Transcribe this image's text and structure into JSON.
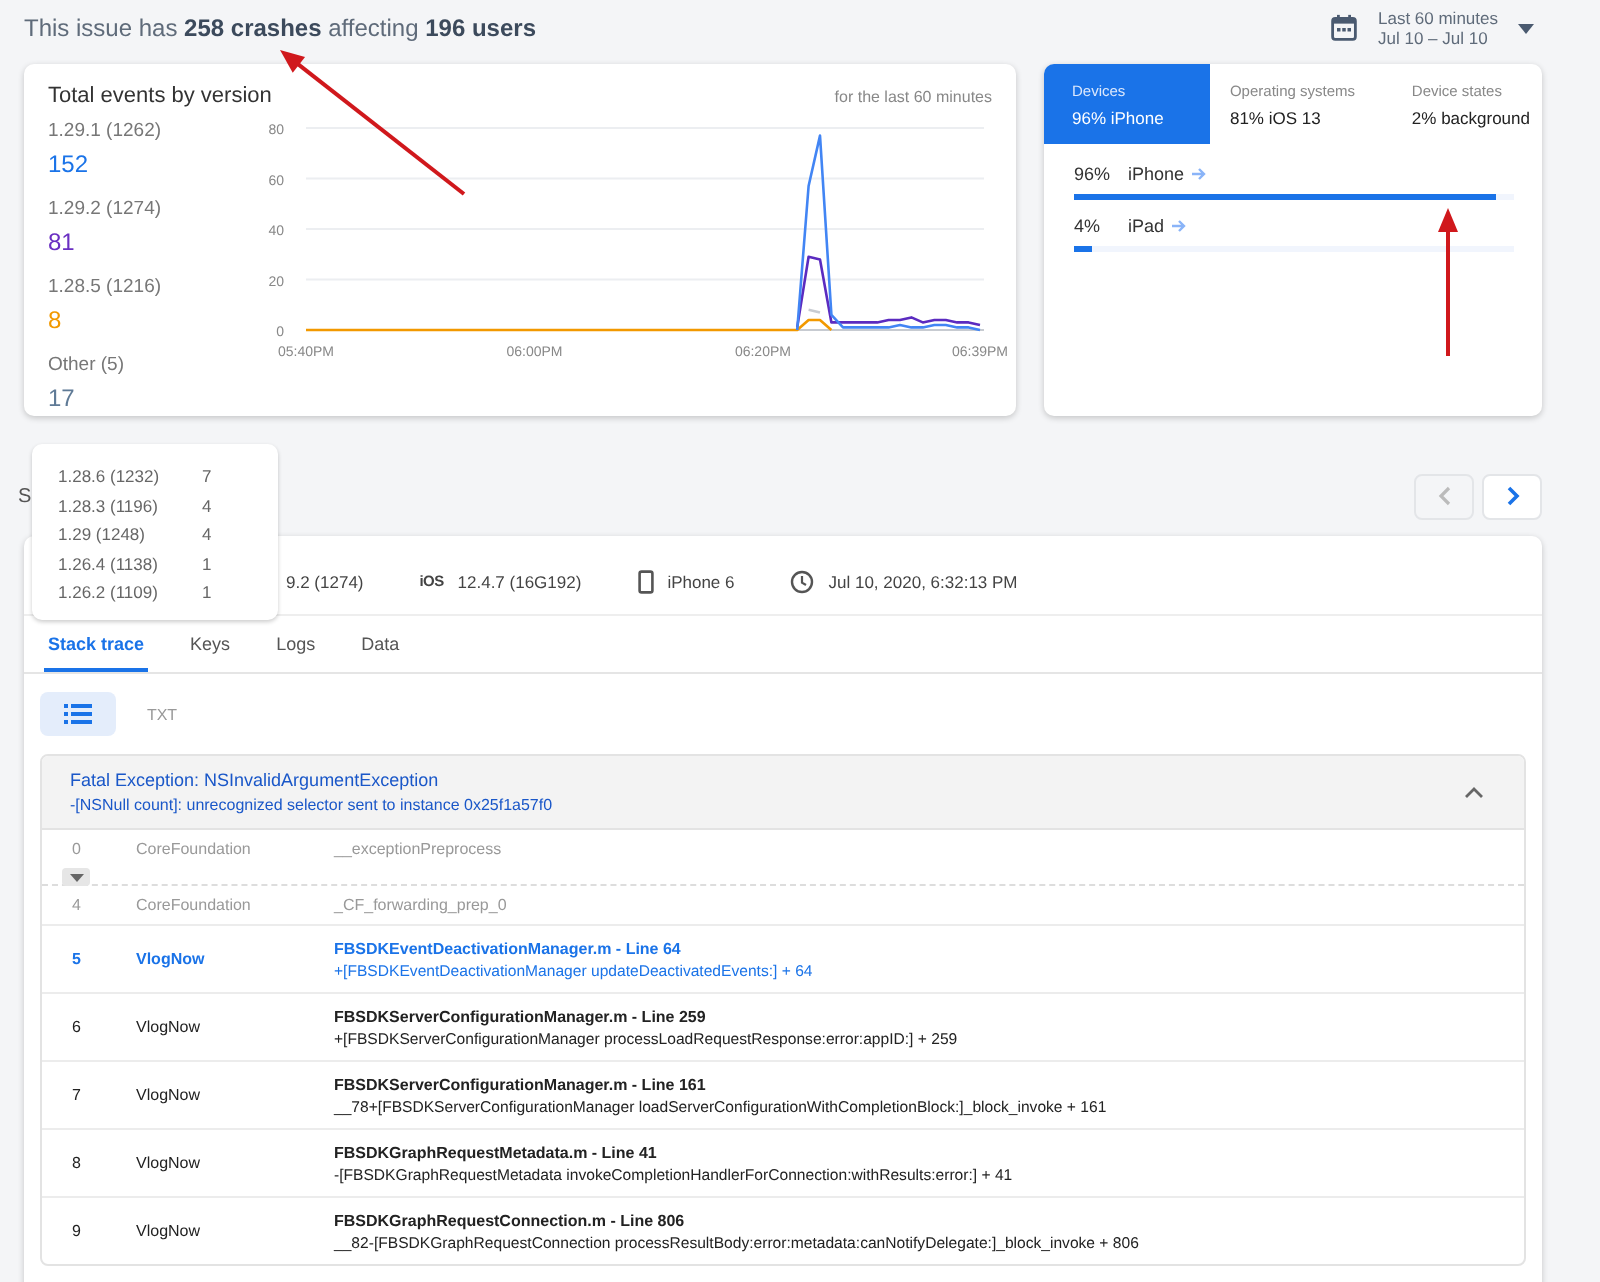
{
  "summary": "This issue has **258 crashes** affecting **196 users**",
  "date_range": {
    "title": "Last 60 minutes",
    "range": "Jul 10 – Jul 10"
  },
  "events_card": {
    "title": "Total events by version",
    "note": "for the last 60 minutes",
    "counts": [
      {
        "value": "152",
        "color": "#1a73e8"
      },
      {
        "value": "81",
        "color": "#6a2fc2"
      },
      {
        "value": "8",
        "color": "#f29900"
      },
      {
        "value": "17",
        "color": "#5f7a96"
      }
    ],
    "chart_data": {
      "type": "line",
      "grid": true,
      "ylim": [
        0,
        80
      ],
      "yticks": [
        0,
        20,
        40,
        60,
        80
      ],
      "categories": [
        "05:40PM",
        null,
        null,
        null,
        null,
        null,
        null,
        null,
        null,
        null,
        null,
        null,
        null,
        null,
        null,
        null,
        null,
        null,
        null,
        null,
        "06:00PM",
        null,
        null,
        null,
        null,
        null,
        null,
        null,
        null,
        null,
        null,
        null,
        null,
        null,
        null,
        null,
        null,
        null,
        null,
        null,
        "06:20PM",
        null,
        null,
        null,
        null,
        null,
        null,
        null,
        null,
        null,
        null,
        null,
        null,
        null,
        null,
        null,
        null,
        null,
        null,
        "06:39PM"
      ],
      "series": [
        {
          "name": "1.29.1 (1262)",
          "color": "#4285f4",
          "values": [
            null,
            null,
            null,
            null,
            null,
            null,
            null,
            null,
            null,
            null,
            null,
            null,
            null,
            null,
            null,
            null,
            null,
            null,
            null,
            null,
            null,
            null,
            null,
            null,
            null,
            null,
            null,
            null,
            null,
            null,
            null,
            null,
            null,
            null,
            null,
            null,
            null,
            null,
            null,
            null,
            null,
            null,
            null,
            0,
            57,
            77,
            6,
            1,
            1,
            1,
            1,
            1,
            2,
            1,
            1,
            2,
            2,
            1,
            1,
            0
          ]
        },
        {
          "name": "1.29.2 (1274)",
          "color": "#5b2bc0",
          "values": [
            null,
            null,
            null,
            null,
            null,
            null,
            null,
            null,
            null,
            null,
            null,
            null,
            null,
            null,
            null,
            null,
            null,
            null,
            null,
            null,
            null,
            null,
            null,
            null,
            null,
            null,
            null,
            null,
            null,
            null,
            null,
            null,
            null,
            null,
            null,
            null,
            null,
            null,
            null,
            null,
            null,
            null,
            null,
            1,
            29,
            28,
            3,
            3,
            3,
            3,
            3,
            4,
            4,
            5,
            3,
            4,
            4,
            3,
            3,
            2
          ]
        },
        {
          "name": "1.28.5 (1216)",
          "color": "#f29900",
          "values": [
            0,
            0,
            0,
            0,
            0,
            0,
            0,
            0,
            0,
            0,
            0,
            0,
            0,
            0,
            0,
            0,
            0,
            0,
            0,
            0,
            0,
            0,
            0,
            0,
            0,
            0,
            0,
            0,
            0,
            0,
            0,
            0,
            0,
            0,
            0,
            0,
            0,
            0,
            0,
            0,
            0,
            0,
            0,
            0,
            4,
            4,
            0,
            null,
            null,
            null,
            null,
            null,
            null,
            null,
            null,
            null,
            null,
            null,
            null,
            null
          ]
        },
        {
          "name": "Other (5)",
          "color": "#c8ccd2",
          "values": [
            null,
            null,
            null,
            null,
            null,
            null,
            null,
            null,
            null,
            null,
            null,
            null,
            null,
            null,
            null,
            null,
            null,
            null,
            null,
            null,
            null,
            null,
            null,
            null,
            null,
            null,
            null,
            null,
            null,
            null,
            null,
            null,
            null,
            null,
            null,
            null,
            null,
            null,
            null,
            null,
            null,
            null,
            null,
            null,
            8,
            7,
            null,
            null,
            null,
            null,
            null,
            null,
            null,
            null,
            null,
            null,
            null,
            null,
            null,
            null
          ]
        }
      ]
    }
  },
  "breakdown_card": {
    "tabs": [
      {
        "label": "Devices",
        "value": "96% iPhone",
        "selected": true
      },
      {
        "label": "Operating systems",
        "value": "81% iOS 13",
        "selected": false
      },
      {
        "label": "Device states",
        "value": "2% background",
        "selected": false
      }
    ],
    "rows": [
      {
        "percent": "96%",
        "name": "iPhone",
        "level": 0.96
      },
      {
        "percent": "4%",
        "name": "iPad",
        "level": 0.04
      }
    ]
  },
  "other_versions_popover": [
    {
      "label": "1.28.6 (1232)",
      "count": "7"
    },
    {
      "label": "1.28.3 (1196)",
      "count": "4"
    },
    {
      "label": "1.29 (1248)",
      "count": "4"
    },
    {
      "label": "1.26.4 (1138)",
      "count": "1"
    },
    {
      "label": "1.26.2 (1109)",
      "count": "1"
    }
  ],
  "section_label": "S",
  "pager": [
    {
      "kind": "previous",
      "disabled": true
    },
    {
      "kind": "next",
      "disabled": false
    }
  ],
  "event_info": {
    "app_version": "9.2 (1274)",
    "os_badge": "iOS",
    "os_version": "12.4.7 (16G192)",
    "device": "iPhone 6",
    "time": "Jul 10, 2020, 6:32:13 PM"
  },
  "event_tabs": [
    {
      "label": "Stack trace",
      "selected": true
    },
    {
      "label": "Keys",
      "selected": false
    },
    {
      "label": "Logs",
      "selected": false
    },
    {
      "label": "Data",
      "selected": false
    }
  ],
  "view_toggle": [
    {
      "kind": "list",
      "selected": true
    },
    {
      "kind": "text",
      "label": "TXT",
      "selected": false
    }
  ],
  "exception": {
    "title": "Fatal Exception: NSInvalidArgumentException",
    "message": "-[NSNull count]: unrecognized selector sent to instance 0x25f1a57f0",
    "expanded": true,
    "frames": [
      {
        "kind": "system",
        "index": "0",
        "library": "CoreFoundation",
        "symbol": "__exceptionPreprocess"
      },
      {
        "kind": "collapsed"
      },
      {
        "kind": "system",
        "index": "4",
        "library": "CoreFoundation",
        "symbol": "_CF_forwarding_prep_0"
      },
      {
        "kind": "app",
        "index": "5",
        "library": "VlogNow",
        "file": "FBSDKEventDeactivationManager.m - Line 64",
        "symbol": "+[FBSDKEventDeactivationManager updateDeactivatedEvents:] + 64",
        "crashed": true
      },
      {
        "kind": "app",
        "index": "6",
        "library": "VlogNow",
        "file": "FBSDKServerConfigurationManager.m - Line 259",
        "symbol": "+[FBSDKServerConfigurationManager processLoadRequestResponse:error:appID:] + 259",
        "crashed": false
      },
      {
        "kind": "app",
        "index": "7",
        "library": "VlogNow",
        "file": "FBSDKServerConfigurationManager.m - Line 161",
        "symbol": "__78+[FBSDKServerConfigurationManager loadServerConfigurationWithCompletionBlock:]_block_invoke + 161",
        "crashed": false
      },
      {
        "kind": "app",
        "index": "8",
        "library": "VlogNow",
        "file": "FBSDKGraphRequestMetadata.m - Line 41",
        "symbol": "-[FBSDKGraphRequestMetadata invokeCompletionHandlerForConnection:withResults:error:] + 41",
        "crashed": false
      },
      {
        "kind": "app",
        "index": "9",
        "library": "VlogNow",
        "file": "FBSDKGraphRequestConnection.m - Line 806",
        "symbol": "__82-[FBSDKGraphRequestConnection processResultBody:error:metadata:canNotifyDelegate:]_block_invoke + 806",
        "crashed": false
      }
    ]
  }
}
